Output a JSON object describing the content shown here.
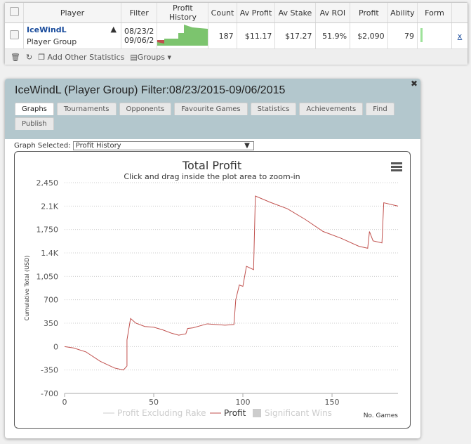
{
  "table": {
    "headers": [
      "Player",
      "Filter",
      "Profit History",
      "Count",
      "Av Profit",
      "Av Stake",
      "Av ROI",
      "Profit",
      "Ability",
      "Form"
    ],
    "row": {
      "player": "IceWindL",
      "group": "Player Group",
      "filter1": "08/23/2",
      "filter2": "09/06/2",
      "count": "187",
      "av_profit": "$11.17",
      "av_stake": "$17.27",
      "av_roi": "51.9%",
      "profit": "$2,090",
      "ability": "79",
      "remove": "x"
    },
    "footer": {
      "add_stats": "Add Other Statistics",
      "groups": "Groups"
    }
  },
  "panel": {
    "title": "IceWindL (Player Group) Filter:08/23/2015-09/06/2015",
    "tabs": [
      "Graphs",
      "Tournaments",
      "Opponents",
      "Favourite Games",
      "Statistics",
      "Achievements",
      "Find",
      "Publish"
    ],
    "graph_label": "Graph Selected:",
    "graph_value": "Profit History"
  },
  "chart_data": {
    "type": "line",
    "title": "Total Profit",
    "subtitle": "Click and drag inside the plot area to zoom-in",
    "ylabel": "Cumulative Total (USD)",
    "xlabel": "No. Games",
    "yticks": [
      "2,450",
      "2.1K",
      "1,750",
      "1.4K",
      "1,050",
      "700",
      "350",
      "0",
      "-350",
      "-700"
    ],
    "ytick_values": [
      2450,
      2100,
      1750,
      1400,
      1050,
      700,
      350,
      0,
      -350,
      -700
    ],
    "xticks": [
      0,
      50,
      100,
      150
    ],
    "xlim": [
      0,
      187
    ],
    "ylim": [
      -700,
      2450
    ],
    "legend": [
      "Profit Excluding Rake",
      "Profit",
      "Significant Wins"
    ],
    "color": "#c0504d",
    "series": [
      {
        "name": "Profit",
        "points": [
          [
            0,
            0
          ],
          [
            5,
            -20
          ],
          [
            12,
            -80
          ],
          [
            20,
            -220
          ],
          [
            28,
            -320
          ],
          [
            33,
            -350
          ],
          [
            35,
            -290
          ],
          [
            35,
            100
          ],
          [
            37,
            420
          ],
          [
            40,
            350
          ],
          [
            45,
            300
          ],
          [
            50,
            290
          ],
          [
            55,
            250
          ],
          [
            60,
            200
          ],
          [
            64,
            170
          ],
          [
            68,
            190
          ],
          [
            69,
            270
          ],
          [
            72,
            280
          ],
          [
            80,
            340
          ],
          [
            90,
            320
          ],
          [
            95,
            330
          ],
          [
            96,
            700
          ],
          [
            98,
            920
          ],
          [
            100,
            900
          ],
          [
            102,
            1200
          ],
          [
            106,
            1150
          ],
          [
            107,
            2250
          ],
          [
            115,
            2160
          ],
          [
            125,
            2060
          ],
          [
            135,
            1900
          ],
          [
            145,
            1720
          ],
          [
            155,
            1620
          ],
          [
            165,
            1500
          ],
          [
            170,
            1470
          ],
          [
            171,
            1720
          ],
          [
            173,
            1580
          ],
          [
            178,
            1550
          ],
          [
            179,
            2150
          ],
          [
            187,
            2100
          ]
        ]
      }
    ]
  }
}
